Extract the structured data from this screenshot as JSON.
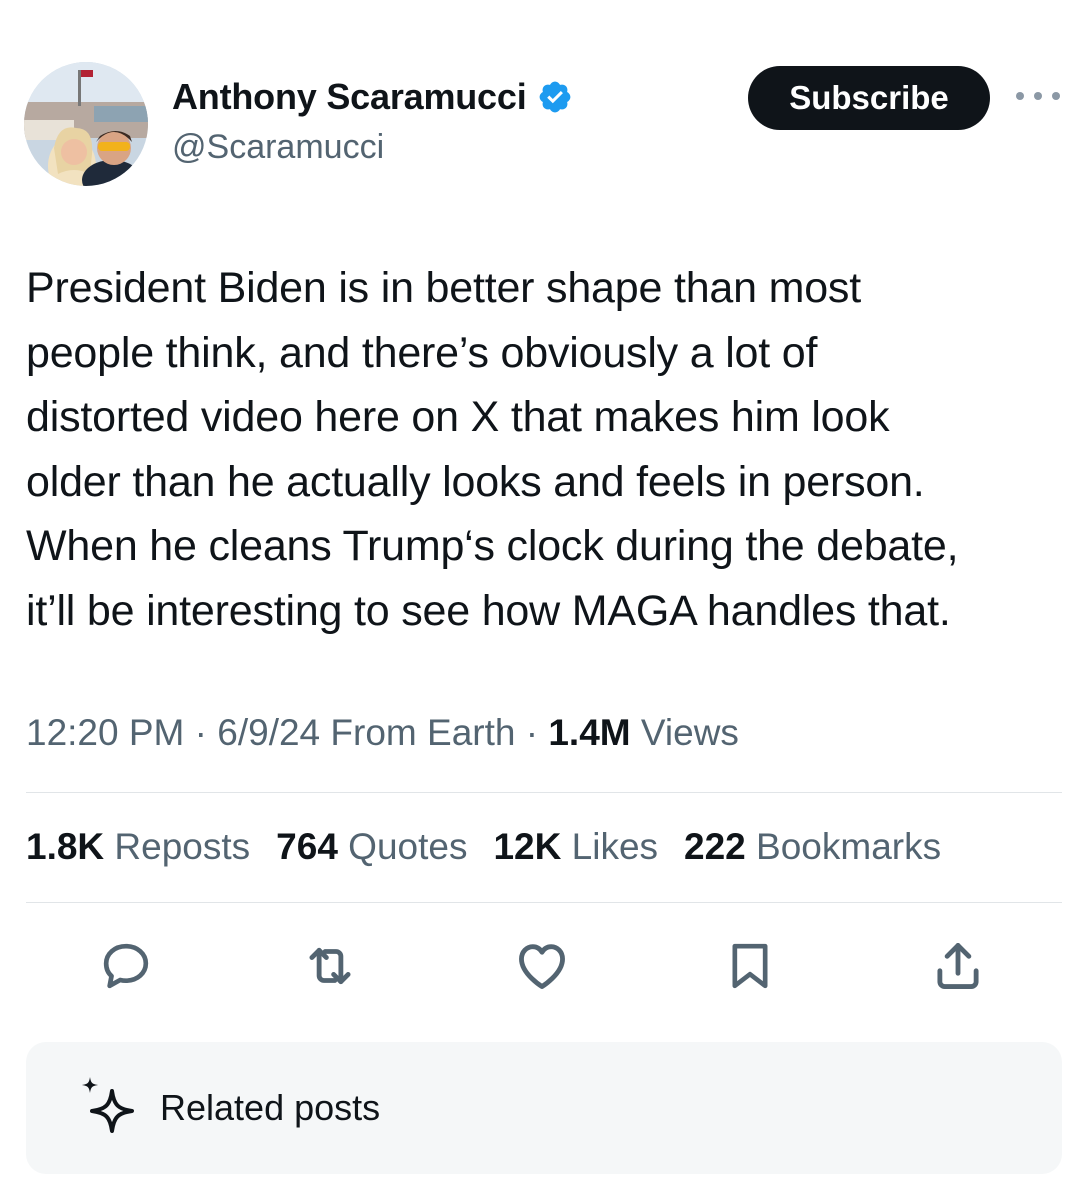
{
  "author": {
    "display_name": "Anthony Scaramucci",
    "handle": "@Scaramucci",
    "verified": true,
    "verified_color": "#1d9bf0"
  },
  "header": {
    "subscribe_label": "Subscribe",
    "more_icon": "more-horizontal-icon"
  },
  "tweet": {
    "lines": [
      "President Biden is in better shape than most",
      "people think, and there’s obviously a lot of",
      "distorted video here on X that makes him look",
      "older than he actually looks and feels in person.",
      "When he cleans Trump‘s clock during the debate,",
      "it’ll be interesting to see how MAGA handles that."
    ]
  },
  "meta": {
    "time": "12:20 PM",
    "sep1": " · ",
    "date": "6/9/24",
    "source": " From Earth",
    "sep2": " · ",
    "views_count": "1.4M",
    "views_label": " Views"
  },
  "stats": [
    {
      "count": "1.8K",
      "label": " Reposts"
    },
    {
      "count": "764",
      "label": " Quotes"
    },
    {
      "count": "12K",
      "label": " Likes"
    },
    {
      "count": "222",
      "label": " Bookmarks"
    }
  ],
  "actions": [
    "reply-icon",
    "repost-icon",
    "like-icon",
    "bookmark-icon",
    "share-icon"
  ],
  "related": {
    "label": "Related posts",
    "icon": "sparkle-icon"
  }
}
